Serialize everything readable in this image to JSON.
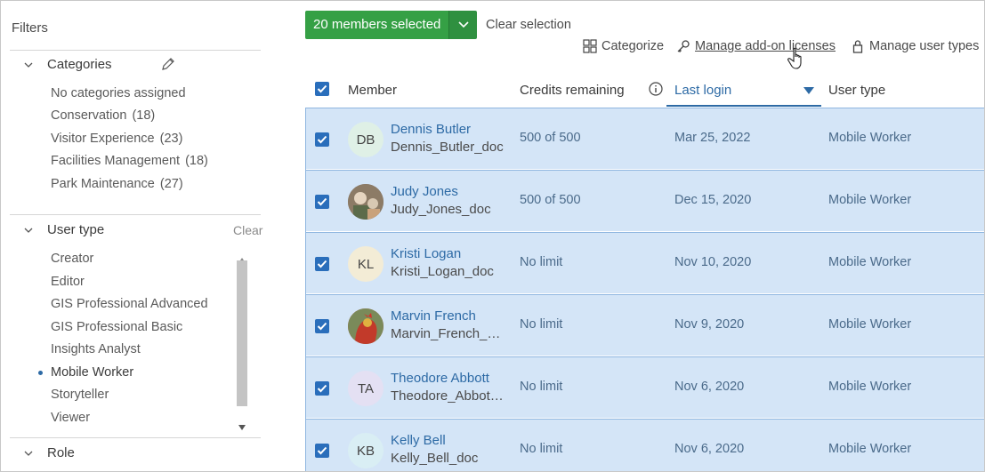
{
  "sidebar": {
    "title": "Filters",
    "categories": {
      "heading": "Categories",
      "items": [
        {
          "label": "No categories assigned",
          "count": ""
        },
        {
          "label": "Conservation",
          "count": "(18)"
        },
        {
          "label": "Visitor Experience",
          "count": "(23)"
        },
        {
          "label": "Facilities Management",
          "count": "(18)"
        },
        {
          "label": "Park Maintenance",
          "count": "(27)"
        }
      ]
    },
    "user_type": {
      "heading": "User type",
      "clear_label": "Clear",
      "items": [
        {
          "label": "Creator"
        },
        {
          "label": "Editor"
        },
        {
          "label": "GIS Professional Advanced"
        },
        {
          "label": "GIS Professional Basic"
        },
        {
          "label": "Insights Analyst"
        },
        {
          "label": "Mobile Worker",
          "selected": true
        },
        {
          "label": "Storyteller"
        },
        {
          "label": "Viewer"
        }
      ]
    },
    "role": {
      "heading": "Role"
    }
  },
  "toolbar": {
    "selected_label": "20 members selected",
    "clear_selection": "Clear selection",
    "categorize": "Categorize",
    "manage_addon": "Manage add-on licenses",
    "manage_user_types": "Manage user types"
  },
  "table": {
    "columns": {
      "member": "Member",
      "credits": "Credits remaining",
      "last_login": "Last login",
      "user_type": "User type"
    },
    "rows": [
      {
        "initials": "DB",
        "avatar_color": "#dff0e6",
        "name": "Dennis Butler",
        "username": "Dennis_Butler_doc",
        "credits": "500 of 500",
        "last_login": "Mar 25, 2022",
        "user_type": "Mobile Worker"
      },
      {
        "initials": "",
        "avatar_color": "#7a6a5a",
        "name": "Judy Jones",
        "username": "Judy_Jones_doc",
        "credits": "500 of 500",
        "last_login": "Dec 15, 2020",
        "user_type": "Mobile Worker"
      },
      {
        "initials": "KL",
        "avatar_color": "#f3ecd6",
        "name": "Kristi Logan",
        "username": "Kristi_Logan_doc",
        "credits": "No limit",
        "last_login": "Nov 10, 2020",
        "user_type": "Mobile Worker"
      },
      {
        "initials": "",
        "avatar_color": "#c23a2a",
        "name": "Marvin French",
        "username": "Marvin_French_doc",
        "credits": "No limit",
        "last_login": "Nov 9, 2020",
        "user_type": "Mobile Worker"
      },
      {
        "initials": "TA",
        "avatar_color": "#e4e0f3",
        "name": "Theodore Abbott",
        "username": "Theodore_Abbott_doc",
        "credits": "No limit",
        "last_login": "Nov 6, 2020",
        "user_type": "Mobile Worker"
      },
      {
        "initials": "KB",
        "avatar_color": "#d9eef4",
        "name": "Kelly Bell",
        "username": "Kelly_Bell_doc",
        "credits": "No limit",
        "last_login": "Nov 6, 2020",
        "user_type": "Mobile Worker"
      }
    ]
  },
  "colors": {
    "accent": "#2d6aa5",
    "selected_row": "#d4e5f7",
    "button_green": "#35a045"
  }
}
